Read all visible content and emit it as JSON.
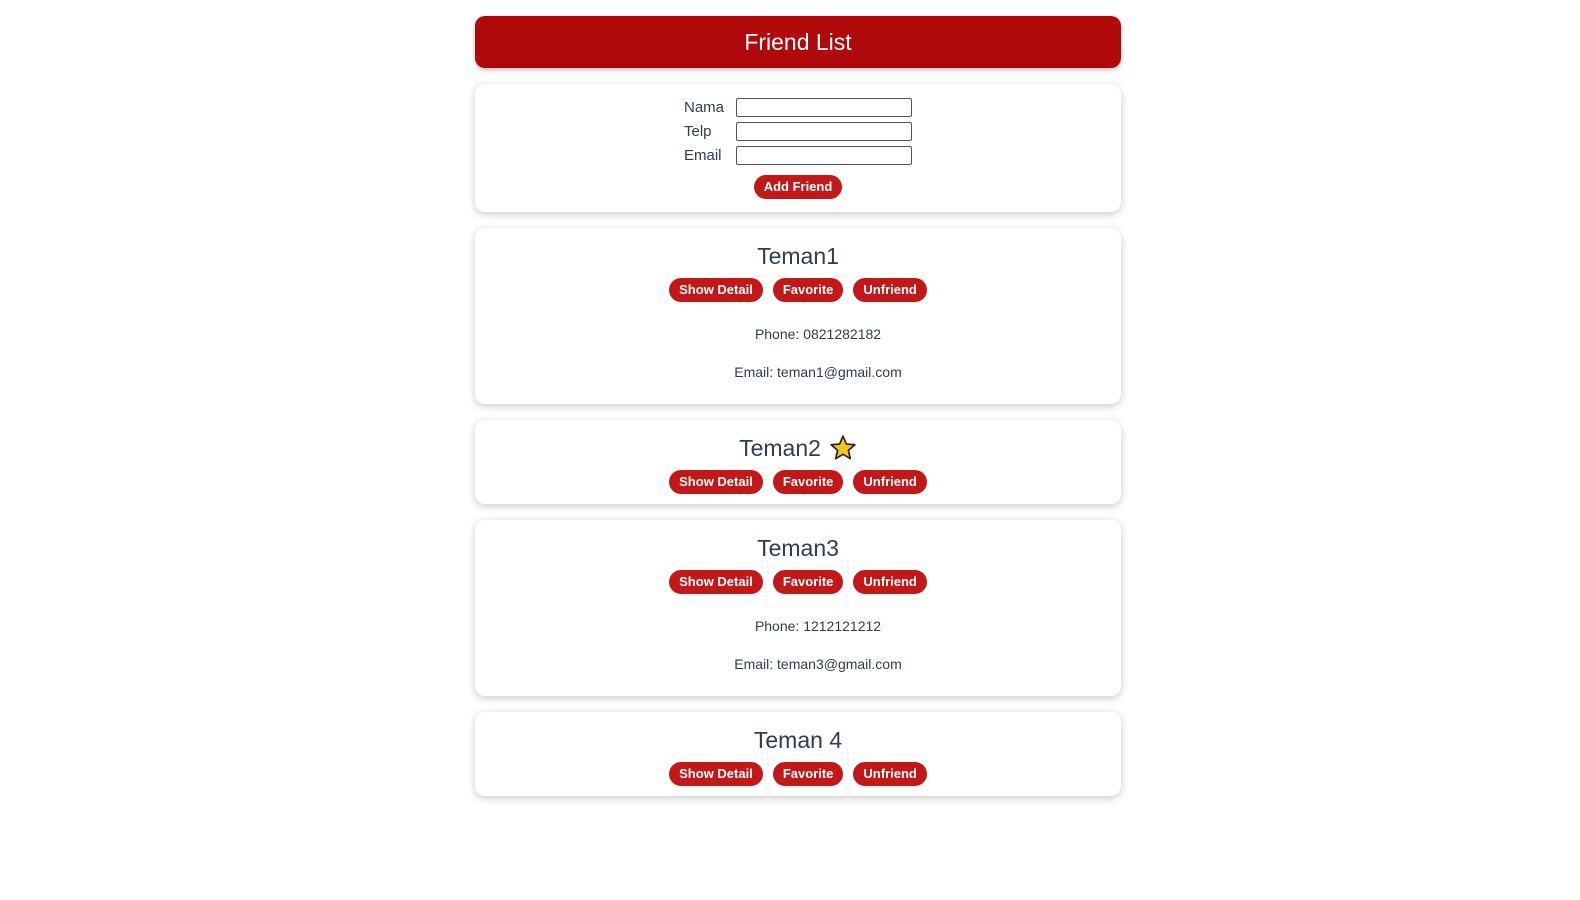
{
  "header": {
    "title": "Friend List"
  },
  "form": {
    "name_label": "Nama",
    "phone_label": "Telp",
    "email_label": "Email",
    "name_value": "",
    "phone_value": "",
    "email_value": "",
    "submit_label": "Add Friend"
  },
  "buttons": {
    "show_detail": "Show Detail",
    "favorite": "Favorite",
    "unfriend": "Unfriend"
  },
  "friends": [
    {
      "name": "Teman1",
      "favorite": false,
      "details_shown": true,
      "phone": "Phone: 0821282182",
      "email": "Email: teman1@gmail.com"
    },
    {
      "name": "Teman2",
      "favorite": true,
      "details_shown": false
    },
    {
      "name": "Teman3",
      "favorite": false,
      "details_shown": true,
      "phone": "Phone: 1212121212",
      "email": "Email: teman3@gmail.com"
    },
    {
      "name": "Teman 4",
      "favorite": false,
      "details_shown": false
    }
  ],
  "colors": {
    "header_bg": "#b0090b",
    "button_bg": "#c21818",
    "text": "#2c3e50",
    "star_fill": "#f7c21b"
  },
  "icons": {
    "favorite": "star-icon"
  }
}
